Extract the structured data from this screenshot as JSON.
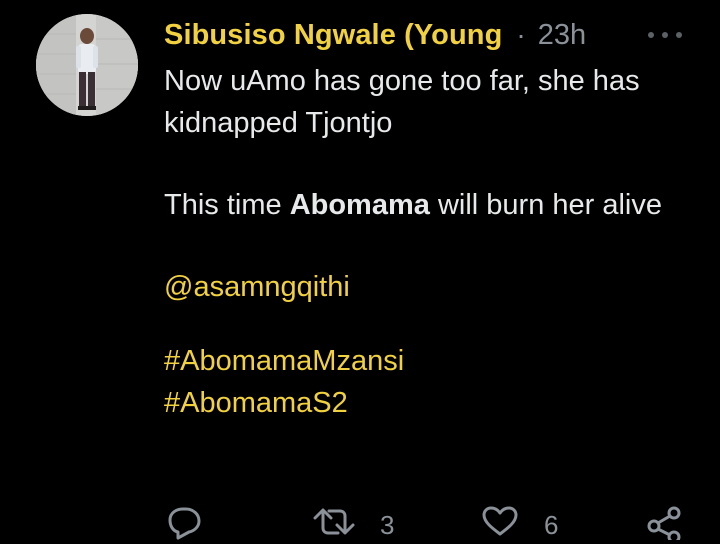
{
  "tweet": {
    "author_name": "Sibusiso Ngwale (Young",
    "separator": "·",
    "time": "23h",
    "line1": "Now uAmo has gone too far, she has kidnapped Tjontjo",
    "line2_pre": "This time ",
    "line2_bold": "Abomama",
    "line2_post": " will burn her alive",
    "mention": "@asamngqithi",
    "hashtags": [
      "#AbomamaMzansi",
      "#AbomamaS2"
    ]
  },
  "actions": {
    "retweet_count": "3",
    "like_count": "6"
  },
  "icons": {
    "avatar": "profile-photo",
    "more": "more-options-icon",
    "reply": "reply-icon",
    "retweet": "retweet-icon",
    "like": "heart-icon",
    "share": "share-icon"
  },
  "colors": {
    "background": "#000000",
    "text": "#e7e9ea",
    "accent": "#f2d13f",
    "muted": "#8b9198"
  }
}
